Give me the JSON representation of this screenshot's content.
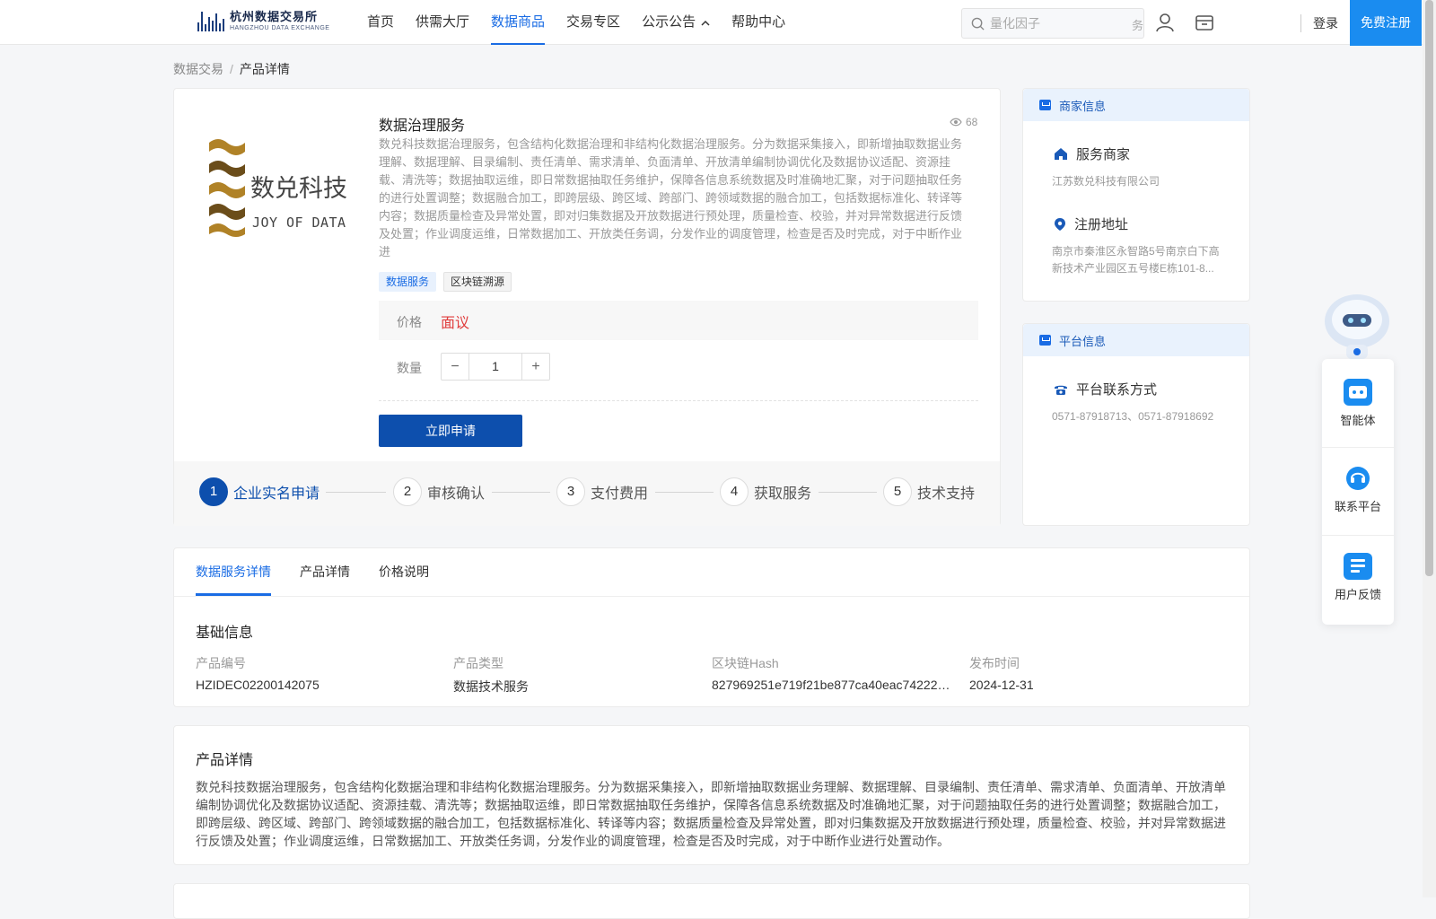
{
  "header": {
    "logo_cn": "杭州数据交易所",
    "logo_en": "HANGZHOU DATA EXCHANGE",
    "nav": [
      {
        "label": "首页"
      },
      {
        "label": "供需大厅"
      },
      {
        "label": "数据商品"
      },
      {
        "label": "交易专区"
      },
      {
        "label": "公示公告"
      },
      {
        "label": "帮助中心"
      }
    ],
    "search_placeholder": "量化因子",
    "search_tail": "务",
    "login": "登录",
    "register": "免费注册"
  },
  "breadcrumb": {
    "root": "数据交易",
    "separator": "/",
    "current": "产品详情"
  },
  "product": {
    "title": "数据治理服务",
    "views": "68",
    "description": "数兑科技数据治理服务，包含结构化数据治理和非结构化数据治理服务。分为数据采集接入，即新增抽取数据业务理解、数据理解、目录编制、责任清单、需求清单、负面清单、开放清单编制协调优化及数据协议适配、资源挂载、清洗等；数据抽取运维，即日常数据抽取任务维护，保障各信息系统数据及时准确地汇聚，对于问题抽取任务的进行处置调整；数据融合加工，即跨层级、跨区域、跨部门、跨领域数据的融合加工，包括数据标准化、转译等内容；数据质量检查及异常处置，即对归集数据及开放数据进行预处理，质量检查、校验，并对异常数据进行反馈及处置；作业调度运维，日常数据加工、开放类任务调，分发作业的调度管理，检查是否及时完成，对于中断作业进",
    "tags": [
      "数据服务",
      "区块链溯源"
    ],
    "price_label": "价格",
    "price_value": "面议",
    "qty_label": "数量",
    "qty_value": "1",
    "qty_minus": "−",
    "qty_plus": "+",
    "apply": "立即申请",
    "steps": [
      {
        "num": "1",
        "label": "企业实名申请"
      },
      {
        "num": "2",
        "label": "审核确认"
      },
      {
        "num": "3",
        "label": "支付费用"
      },
      {
        "num": "4",
        "label": "获取服务"
      },
      {
        "num": "5",
        "label": "技术支持"
      }
    ]
  },
  "merchant": {
    "head": "商家信息",
    "service_title": "服务商家",
    "service_value": "江苏数兑科技有限公司",
    "address_title": "注册地址",
    "address_value": "南京市秦淮区永智路5号南京白下高新技术产业园区五号楼E栋101-8..."
  },
  "platform": {
    "head": "平台信息",
    "contact_title": "平台联系方式",
    "contact_value": "0571-87918713、0571-87918692"
  },
  "float": [
    {
      "label": "智能体"
    },
    {
      "label": "联系平台"
    },
    {
      "label": "用户反馈"
    }
  ],
  "tabs": [
    {
      "label": "数据服务详情"
    },
    {
      "label": "产品详情"
    },
    {
      "label": "价格说明"
    }
  ],
  "basic": {
    "title": "基础信息",
    "fields": [
      {
        "k": "产品编号",
        "v": "HZIDEC02200142075"
      },
      {
        "k": "产品类型",
        "v": "数据技术服务"
      },
      {
        "k": "区块链Hash",
        "v": "827969251e719f21be877ca40eac742223..."
      },
      {
        "k": "发布时间",
        "v": "2024-12-31"
      }
    ]
  },
  "detail": {
    "title": "产品详情",
    "text": "数兑科技数据治理服务，包含结构化数据治理和非结构化数据治理服务。分为数据采集接入，即新增抽取数据业务理解、数据理解、目录编制、责任清单、需求清单、负面清单、开放清单编制协调优化及数据协议适配、资源挂载、清洗等；数据抽取运维，即日常数据抽取任务维护，保障各信息系统数据及时准确地汇聚，对于问题抽取任务的进行处置调整；数据融合加工，即跨层级、跨区域、跨部门、跨领域数据的融合加工，包括数据标准化、转译等内容；数据质量检查及异常处置，即对归集数据及开放数据进行预处理，质量检查、校验，并对异常数据进行反馈及处置；作业调度运维，日常数据加工、开放类任务调，分发作业的调度管理，检查是否及时完成，对于中断作业进行处置动作。"
  },
  "brand_logo_text": {
    "cn": "数兑科技",
    "en": "JOY OF DATA"
  },
  "colors": {
    "accent": "#1a6ce4",
    "primary_button": "#0d4fad",
    "price": "#e03c3c",
    "register": "#1a8cf0"
  }
}
